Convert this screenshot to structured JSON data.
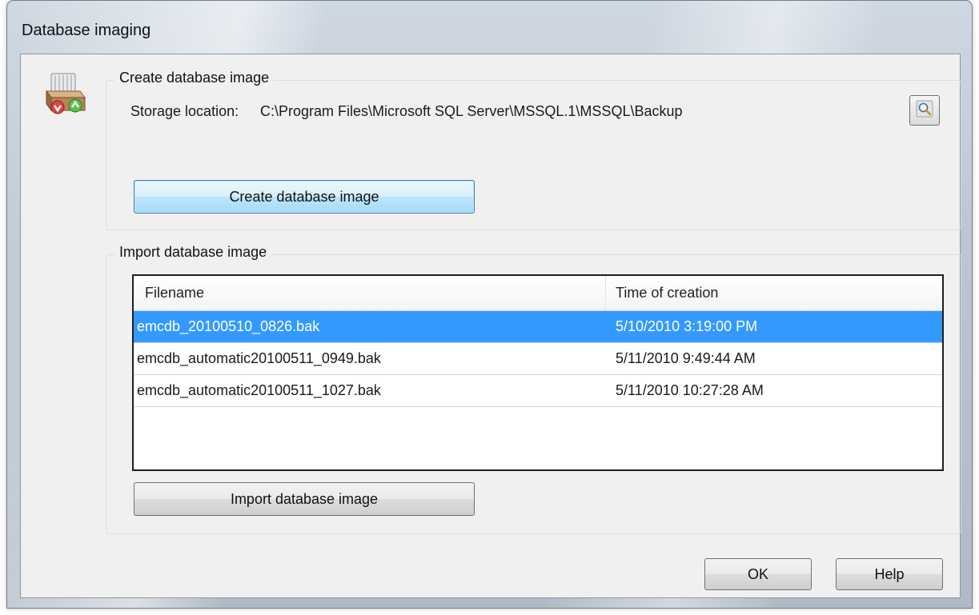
{
  "window": {
    "title": "Database imaging"
  },
  "create_group": {
    "legend": "Create database image",
    "storage_label": "Storage location:",
    "storage_path": "C:\\Program Files\\Microsoft SQL Server\\MSSQL.1\\MSSQL\\Backup",
    "create_button": "Create database image"
  },
  "import_group": {
    "legend": "Import database image",
    "columns": {
      "filename": "Filename",
      "time": "Time of creation"
    },
    "rows": [
      {
        "filename": "emcdb_20100510_0826.bak",
        "time": "5/10/2010 3:19:00 PM",
        "selected": true
      },
      {
        "filename": "emcdb_automatic20100511_0949.bak",
        "time": "5/11/2010 9:49:44 AM",
        "selected": false
      },
      {
        "filename": "emcdb_automatic20100511_1027.bak",
        "time": "5/11/2010 10:27:28 AM",
        "selected": false
      }
    ],
    "import_button": "Import database image"
  },
  "footer": {
    "ok_label": "OK",
    "help_label": "Help"
  },
  "icons": {
    "app": "database-image-icon",
    "browse": "magnifier-icon"
  },
  "colors": {
    "selection": "#3399ff",
    "default_button_border": "#3c7fb1"
  }
}
